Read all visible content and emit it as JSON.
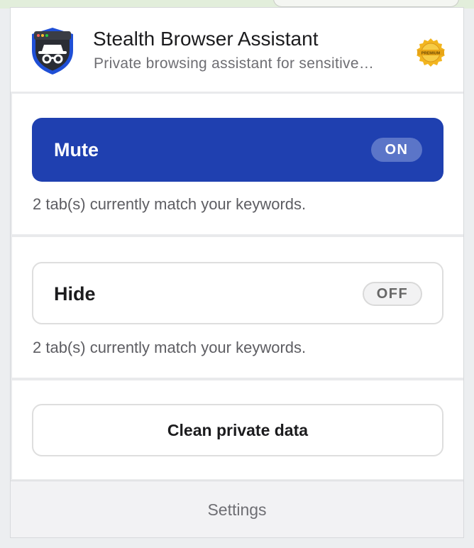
{
  "app": {
    "title": "Stealth Browser Assistant",
    "subtitle": "Private browsing assistant for sensitive…",
    "logo_icon": "incognito-shield-icon",
    "badge_icon": "premium-seal-icon",
    "badge_text": "PREMIUM"
  },
  "mute": {
    "label": "Mute",
    "state": "ON",
    "status": "2 tab(s) currently match your keywords."
  },
  "hide": {
    "label": "Hide",
    "state": "OFF",
    "status": "2 tab(s) currently match your keywords."
  },
  "clean": {
    "label": "Clean private data"
  },
  "footer": {
    "settings_label": "Settings"
  },
  "colors": {
    "accent": "#1f40b0",
    "on_pill": "#5b75c8",
    "badge_gold": "#f2b51f"
  }
}
